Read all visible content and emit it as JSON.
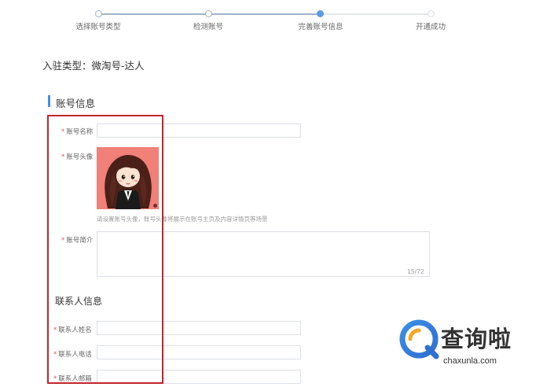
{
  "stepper": {
    "steps": [
      {
        "label": "选择账号类型",
        "state": "done"
      },
      {
        "label": "检测账号",
        "state": "done"
      },
      {
        "label": "完善账号信息",
        "state": "current"
      },
      {
        "label": "开通成功",
        "state": "pending"
      }
    ],
    "colors": {
      "done": "#9fb3c8",
      "current": "#5b9ae8",
      "pending": "#d8dde3"
    }
  },
  "account_type": "入驻类型：微淘号-达人",
  "account_section": {
    "title": "账号信息",
    "name_label": "账号名称",
    "name_value": "",
    "avatar_label": "账号头像",
    "avatar_hint": "请设置账号头像，账号头像将展示在账号主页及内容详情页等场景",
    "intro_label": "账号简介",
    "intro_value": "",
    "intro_counter": "15/72"
  },
  "contact_section": {
    "title": "联系人信息",
    "name_label": "联系人姓名",
    "phone_label": "联系人电话",
    "email_label": "联系人邮箱"
  },
  "required_mark": "*",
  "highlight_color": "#c0262d",
  "watermark": {
    "cn": "查询啦",
    "en": "chaxunla.com"
  }
}
